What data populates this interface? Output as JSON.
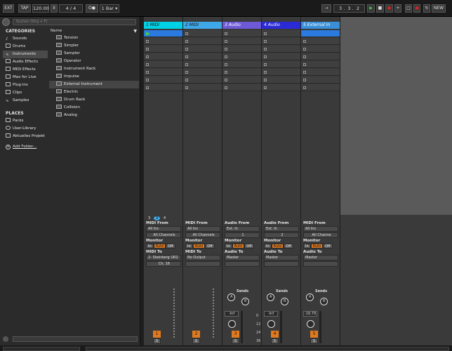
{
  "transport": {
    "ext": "EXT",
    "tap": "TAP",
    "tempo": "120.00",
    "pause_glyph": "II",
    "sig_num": "4",
    "sig_slash": "/",
    "sig_den": "4",
    "metronome": "O●",
    "quantize": "1 Bar",
    "position": [
      "3",
      "3",
      "2"
    ],
    "new_label": "NEW"
  },
  "browser": {
    "search_placeholder": "Suchen (Strg + F)",
    "categories_header": "CATEGORIES",
    "categories": [
      "Sounds",
      "Drums",
      "Instruments",
      "Audio Effects",
      "MIDI Effects",
      "Max for Live",
      "Plug-ins",
      "Clips",
      "Samples"
    ],
    "places_header": "PLACES",
    "places": [
      "Packs",
      "User-Library",
      "Aktuelles Projekt"
    ],
    "add_folder": "Add Folder...",
    "name_header": "Name",
    "names": [
      "Tension",
      "Simpler",
      "Sampler",
      "Operator",
      "Instrument Rack",
      "Impulse",
      "External Instrument",
      "Electric",
      "Drum Rack",
      "Collision",
      "Analog"
    ]
  },
  "tracks": [
    {
      "name": "1 MIDI",
      "color": "#00d2e6",
      "text": "#111111",
      "type": "midi",
      "from_label": "MIDI From",
      "from": "All Ins",
      "chan": "All Channels",
      "to_label": "MIDI To",
      "to": "2- Steinberg UR2",
      "to2": "Ch. 16",
      "num": "1"
    },
    {
      "name": "2 MIDI",
      "color": "#3fa8e8",
      "text": "#111111",
      "type": "midi",
      "from_label": "MIDI From",
      "from": "All Ins",
      "chan": "All Channels",
      "to_label": "MIDI To",
      "to": "No Output",
      "to2": "",
      "num": "2"
    },
    {
      "name": "3 Audio",
      "color": "#6e5ad6",
      "text": "#ffffff",
      "type": "audio",
      "from_label": "Audio From",
      "from": "Ext. In",
      "chan": "1",
      "to_label": "Audio To",
      "to": "Master",
      "to2": "",
      "num": "3",
      "vol": "-Inf"
    },
    {
      "name": "4 Audio",
      "color": "#2a2ad6",
      "text": "#ffffff",
      "type": "audio",
      "from_label": "Audio From",
      "from": "Ext. In",
      "chan": "2",
      "to_label": "Audio To",
      "to": "Master",
      "to2": "",
      "num": "4",
      "vol": "-Inf"
    },
    {
      "name": "5 External In",
      "color": "#3a90d8",
      "text": "#ffffff",
      "type": "audio",
      "from_label": "MIDI From",
      "from": "All Ins",
      "chan": "All Channe",
      "to_label": "Audio To",
      "to": "Master",
      "to2": "",
      "num": "5",
      "vol": "-19.79"
    }
  ],
  "scene_nums": [
    "3",
    "3",
    "4"
  ],
  "monitor": {
    "label": "Monitor",
    "in": "In",
    "auto": "Auto",
    "off": "Off"
  },
  "sends": {
    "label": "Sends",
    "a": "A",
    "b": "B"
  },
  "solo": "S",
  "meter_scale": [
    "0",
    "12",
    "24",
    "36",
    "48",
    "60"
  ]
}
